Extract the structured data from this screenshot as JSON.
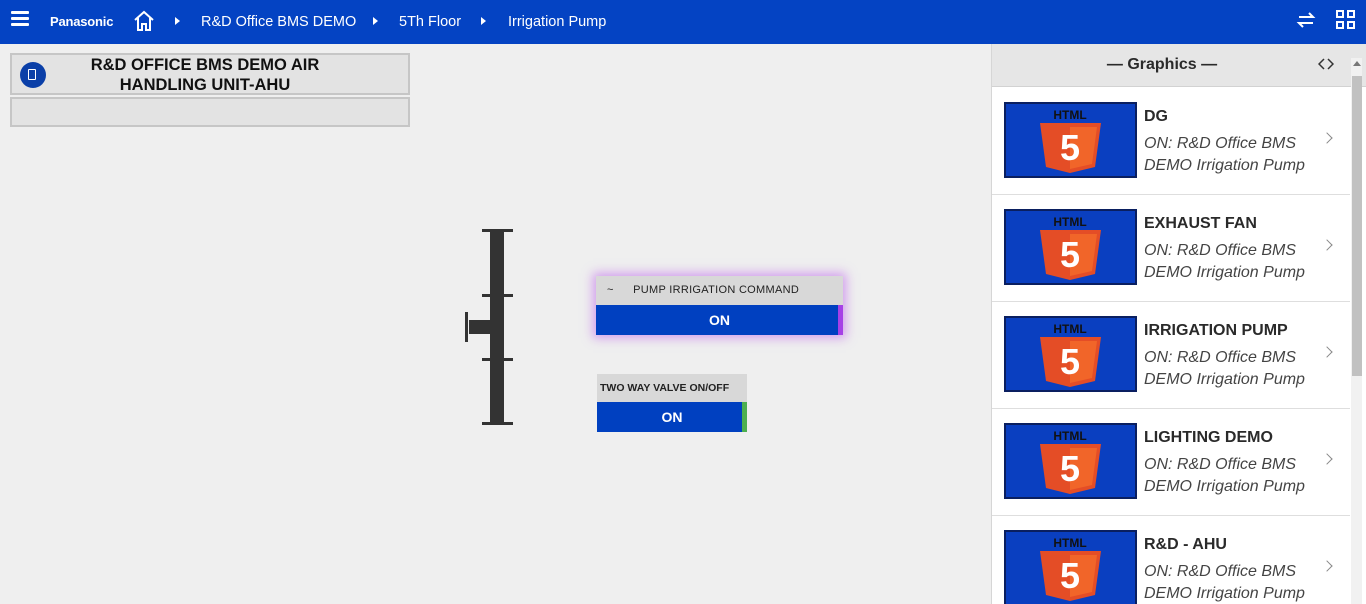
{
  "topbar": {
    "brand": "Panasonic",
    "breadcrumbs": [
      "R&D Office BMS DEMO",
      "5Th Floor",
      "Irrigation Pump"
    ]
  },
  "title": {
    "line1": "R&D OFFICE BMS DEMO AIR",
    "line2": "HANDLING UNIT-AHU"
  },
  "controls": {
    "pump": {
      "label": "PUMP IRRIGATION COMMAND",
      "prefix": "~",
      "value": "ON"
    },
    "valve": {
      "label": "TWO WAY VALVE ON/OFF",
      "value": "ON"
    }
  },
  "panel": {
    "title": "— Graphics —",
    "items": [
      {
        "name": "DG",
        "desc": "ON: R&D Office BMS DEMO Irrigation Pump"
      },
      {
        "name": "EXHAUST FAN",
        "desc": "ON: R&D Office BMS DEMO Irrigation Pump"
      },
      {
        "name": "IRRIGATION PUMP",
        "desc": "ON: R&D Office BMS DEMO Irrigation Pump"
      },
      {
        "name": "LIGHTING DEMO",
        "desc": "ON: R&D Office BMS DEMO Irrigation Pump"
      },
      {
        "name": "R&D - AHU",
        "desc": "ON: R&D Office BMS DEMO Irrigation Pump"
      }
    ],
    "thumb_label": "HTML",
    "thumb_number": "5"
  },
  "colors": {
    "topbar": "#0443c3",
    "value_bg": "#0040c0",
    "pump_accent": "#a640e6",
    "valve_accent": "#4caf50",
    "html5_orange": "#e44d26"
  }
}
